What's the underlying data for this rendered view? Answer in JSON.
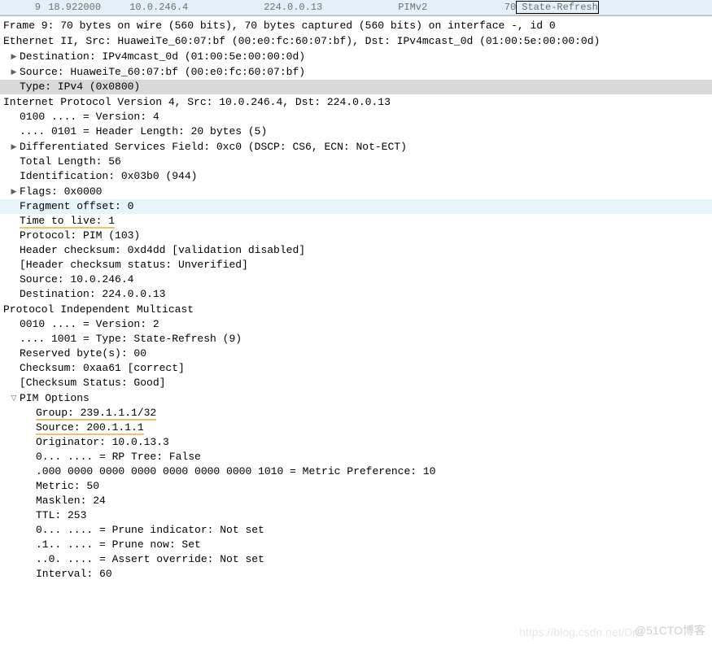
{
  "packet": {
    "num": "9",
    "time": "18.922000",
    "src": "10.0.246.4",
    "dst": "224.0.0.13",
    "proto": "PIMv2",
    "len": "70",
    "info": "State-Refresh"
  },
  "frame": "Frame 9: 70 bytes on wire (560 bits), 70 bytes captured (560 bits) on interface -, id 0",
  "eth": {
    "summary": "Ethernet II, Src: HuaweiTe_60:07:bf (00:e0:fc:60:07:bf), Dst: IPv4mcast_0d (01:00:5e:00:00:0d)",
    "dst": "Destination: IPv4mcast_0d (01:00:5e:00:00:0d)",
    "src": "Source: HuaweiTe_60:07:bf (00:e0:fc:60:07:bf)",
    "type": "Type: IPv4 (0x0800)"
  },
  "ip": {
    "summary": "Internet Protocol Version 4, Src: 10.0.246.4, Dst: 224.0.0.13",
    "version": "0100 .... = Version: 4",
    "hdrlen": ".... 0101 = Header Length: 20 bytes (5)",
    "dsf": "Differentiated Services Field: 0xc0 (DSCP: CS6, ECN: Not-ECT)",
    "totallen": "Total Length: 56",
    "ident": "Identification: 0x03b0 (944)",
    "flags": "Flags: 0x0000",
    "fragoff": "Fragment offset: 0",
    "ttl": "Time to live: 1",
    "proto": "Protocol: PIM (103)",
    "hcksum": "Header checksum: 0xd4dd [validation disabled]",
    "hcksumstat": "[Header checksum status: Unverified]",
    "srcaddr": "Source: 10.0.246.4",
    "dstaddr": "Destination: 224.0.0.13"
  },
  "pim": {
    "summary": "Protocol Independent Multicast",
    "version": "0010 .... = Version: 2",
    "type": ".... 1001 = Type: State-Refresh (9)",
    "reserved": "Reserved byte(s): 00",
    "cksum": "Checksum: 0xaa61 [correct]",
    "cksumstat": "[Checksum Status: Good]",
    "options": "PIM Options",
    "group": "Group: 239.1.1.1/32",
    "source": "Source: 200.1.1.1",
    "originator": "Originator: 10.0.13.3",
    "rptree": "0... .... = RP Tree: False",
    "metricpref": ".000 0000 0000 0000 0000 0000 0000 1010 = Metric Preference: 10",
    "metric": "Metric: 50",
    "masklen": "Masklen: 24",
    "pimttl": "TTL: 253",
    "prune_ind": "0... .... = Prune indicator: Not set",
    "prune_now": ".1.. .... = Prune now: Set",
    "assert_over": "..0. .... = Assert override: Not set",
    "interval": "Interval: 60"
  },
  "watermark": "@51CTO博客",
  "watermark2": "https://blog.csdn.net/Dra"
}
